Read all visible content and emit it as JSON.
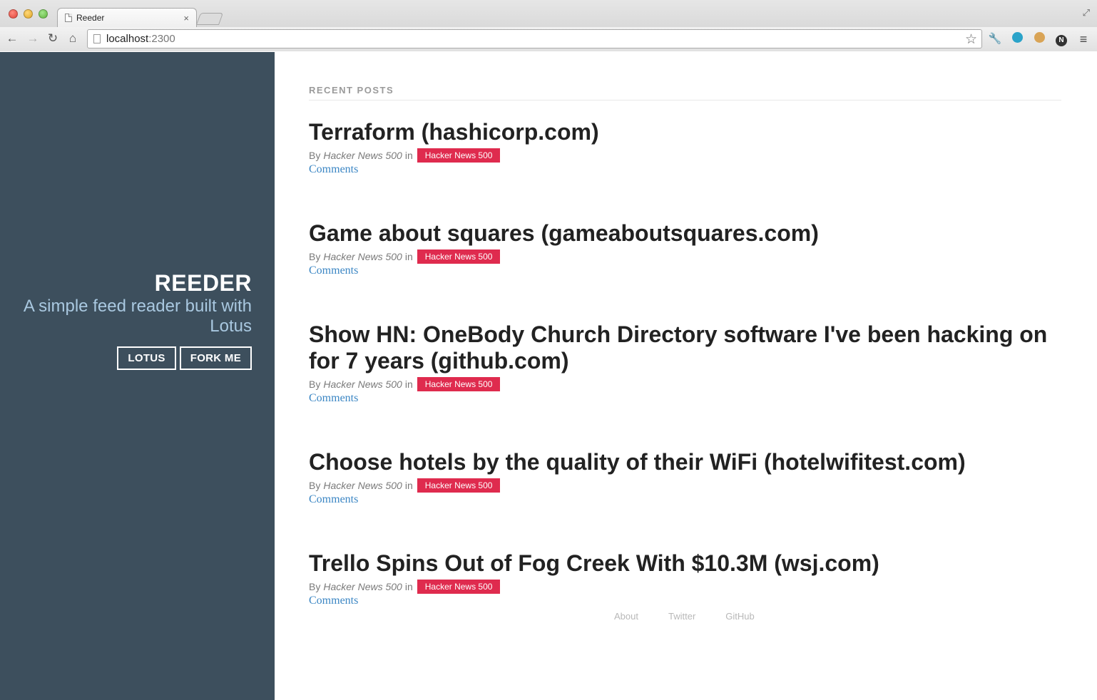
{
  "browser": {
    "tab_title": "Reeder",
    "tab_close": "×",
    "url_host": "localhost",
    "url_port": ":2300"
  },
  "sidebar": {
    "title": "REEDER",
    "tagline": "A simple feed reader built with Lotus",
    "buttons": [
      "LOTUS",
      "FORK ME"
    ]
  },
  "main": {
    "section_title": "RECENT POSTS",
    "posts": [
      {
        "title": "Terraform (hashicorp.com)",
        "by": "By",
        "author": "Hacker News 500",
        "in": "in",
        "feed": "Hacker News 500",
        "comments": "Comments"
      },
      {
        "title": "Game about squares (gameaboutsquares.com)",
        "by": "By",
        "author": "Hacker News 500",
        "in": "in",
        "feed": "Hacker News 500",
        "comments": "Comments"
      },
      {
        "title": "Show HN: OneBody Church Directory software I've been hacking on for 7 years (github.com)",
        "by": "By",
        "author": "Hacker News 500",
        "in": "in",
        "feed": "Hacker News 500",
        "comments": "Comments"
      },
      {
        "title": "Choose hotels by the quality of their WiFi (hotelwifitest.com)",
        "by": "By",
        "author": "Hacker News 500",
        "in": "in",
        "feed": "Hacker News 500",
        "comments": "Comments"
      },
      {
        "title": "Trello Spins Out of Fog Creek With $10.3M (wsj.com)",
        "by": "By",
        "author": "Hacker News 500",
        "in": "in",
        "feed": "Hacker News 500",
        "comments": "Comments"
      }
    ]
  },
  "footer": {
    "links": [
      "About",
      "Twitter",
      "GitHub"
    ]
  },
  "colors": {
    "sidebar_bg": "#3d4f5d",
    "tagline": "#a9c8e0",
    "badge": "#df2b4e",
    "link": "#3b86c4"
  },
  "icons": [
    "close-icon",
    "back-icon",
    "forward-icon",
    "reload-icon",
    "home-icon",
    "page-icon",
    "star-icon",
    "wrench-icon",
    "extension-icon",
    "cookie-icon",
    "n-icon",
    "menu-icon",
    "fullscreen-icon"
  ]
}
